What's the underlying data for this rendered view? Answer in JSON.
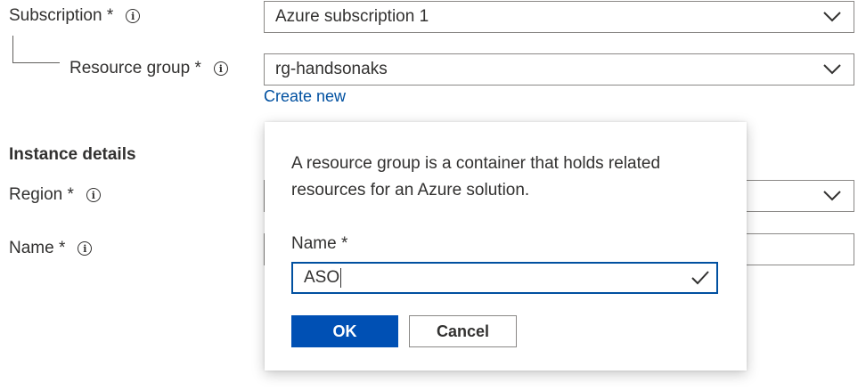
{
  "form": {
    "subscription": {
      "label": "Subscription *",
      "value": "Azure subscription 1"
    },
    "resource_group": {
      "label": "Resource group *",
      "value": "rg-handsonaks",
      "create_new": "Create new"
    },
    "instance_heading": "Instance details",
    "region": {
      "label": "Region *"
    },
    "name": {
      "label": "Name *"
    }
  },
  "popup": {
    "description": "A resource group is a container that holds related resources for an Azure solution.",
    "name_label": "Name *",
    "name_value": "ASO",
    "ok_label": "OK",
    "cancel_label": "Cancel"
  },
  "colors": {
    "accent": "#0050b4",
    "link": "#0050a0",
    "border": "#8a8886"
  },
  "icons": {
    "info": "info-icon",
    "dropdown": "chevron-down-icon",
    "valid": "checkmark-icon"
  }
}
